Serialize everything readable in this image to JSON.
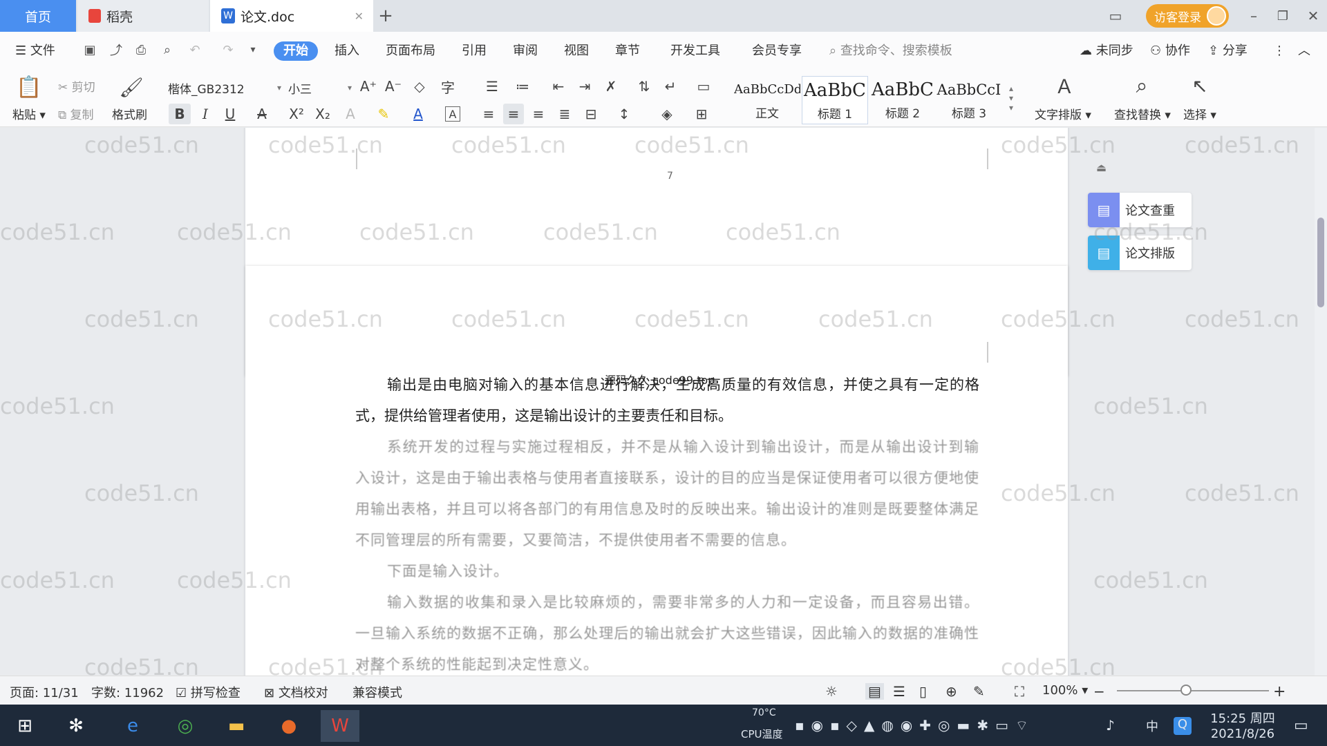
{
  "tabs": {
    "home": "首页",
    "daoke": "稻壳",
    "doc": "论文.doc"
  },
  "login": "访客登录",
  "menus": {
    "file": "文件",
    "start": "开始",
    "insert": "插入",
    "layout": "页面布局",
    "reference": "引用",
    "review": "审阅",
    "view": "视图",
    "chapter": "章节",
    "devtools": "开发工具",
    "member": "会员专享",
    "search": "查找命令、搜索模板",
    "unsync": "未同步",
    "collab": "协作",
    "share": "分享"
  },
  "ribbon": {
    "paste": "粘贴",
    "cut": "剪切",
    "copy": "复制",
    "format_painter": "格式刷",
    "font_name": "楷体_GB2312",
    "font_size": "小三",
    "text_layout": "文字排版",
    "find_replace": "查找替换",
    "select": "选择"
  },
  "styles": [
    {
      "preview": "AaBbCcDd",
      "name": "正文"
    },
    {
      "preview": "AaBbC",
      "name": "标题 1"
    },
    {
      "preview": "AaBbC",
      "name": "标题 2"
    },
    {
      "preview": "AaBbCcI",
      "name": "标题 3"
    }
  ],
  "side_panel": {
    "check": "论文查重",
    "format": "论文排版"
  },
  "page_number": "7",
  "overlay_text": "源码久久 code99.top",
  "paragraphs": [
    "输出是由电脑对输入的基本信息进行解决，生成高质量的有效信息，并使之具有一定的格式，提供给管理者使用，这是输出设计的主要责任和目标。",
    "系统开发的过程与实施过程相反，并不是从输入设计到输出设计，而是从输出设计到输入设计，这是由于输出表格与使用者直接联系，设计的目的应当是保证使用者可以很方便地使用输出表格，并且可以将各部门的有用信息及时的反映出来。输出设计的准则是既要整体满足不同管理层的所有需要，又要简洁，不提供使用者不需要的信息。",
    "下面是输入设计。",
    "输入数据的收集和录入是比较麻烦的，需要非常多的人力和一定设备，而且容易出错。一旦输入系统的数据不正确，那么处理后的输出就会扩大这些错误，因此输入的数据的准确性对整个系统的性能起到决定性意义。"
  ],
  "watermark": "code51.cn",
  "status": {
    "page": "页面: 11/31",
    "words": "字数: 11962",
    "spell": "拼写检查",
    "proof": "文档校对",
    "compat": "兼容模式",
    "zoom": "100%"
  },
  "tray": {
    "temp": "70°C",
    "cpu": "CPU温度",
    "time": "15:25 周四",
    "date": "2021/8/26",
    "ime": "中"
  }
}
